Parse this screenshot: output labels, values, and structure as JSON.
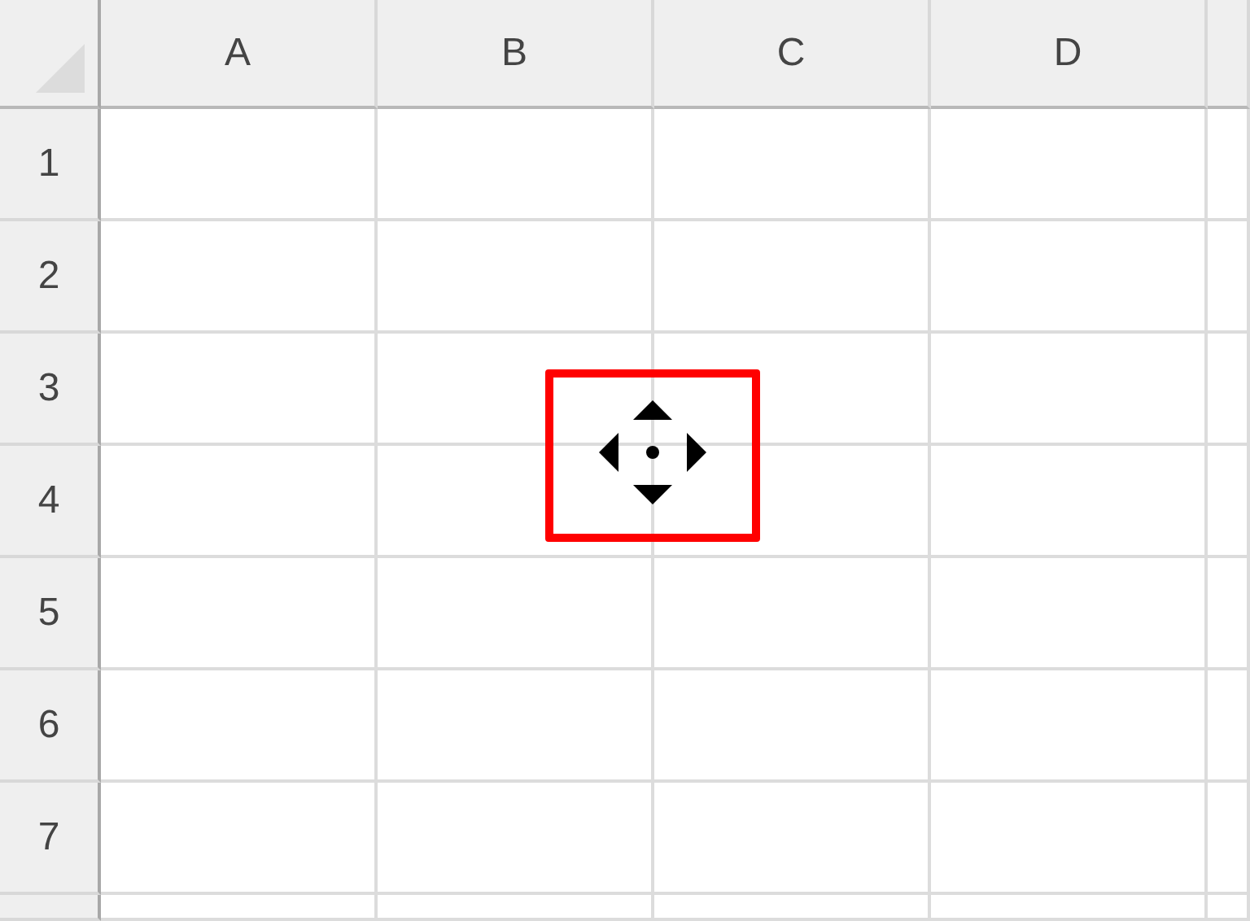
{
  "columns": [
    "A",
    "B",
    "C",
    "D"
  ],
  "rows": [
    "1",
    "2",
    "3",
    "4",
    "5",
    "6",
    "7"
  ]
}
